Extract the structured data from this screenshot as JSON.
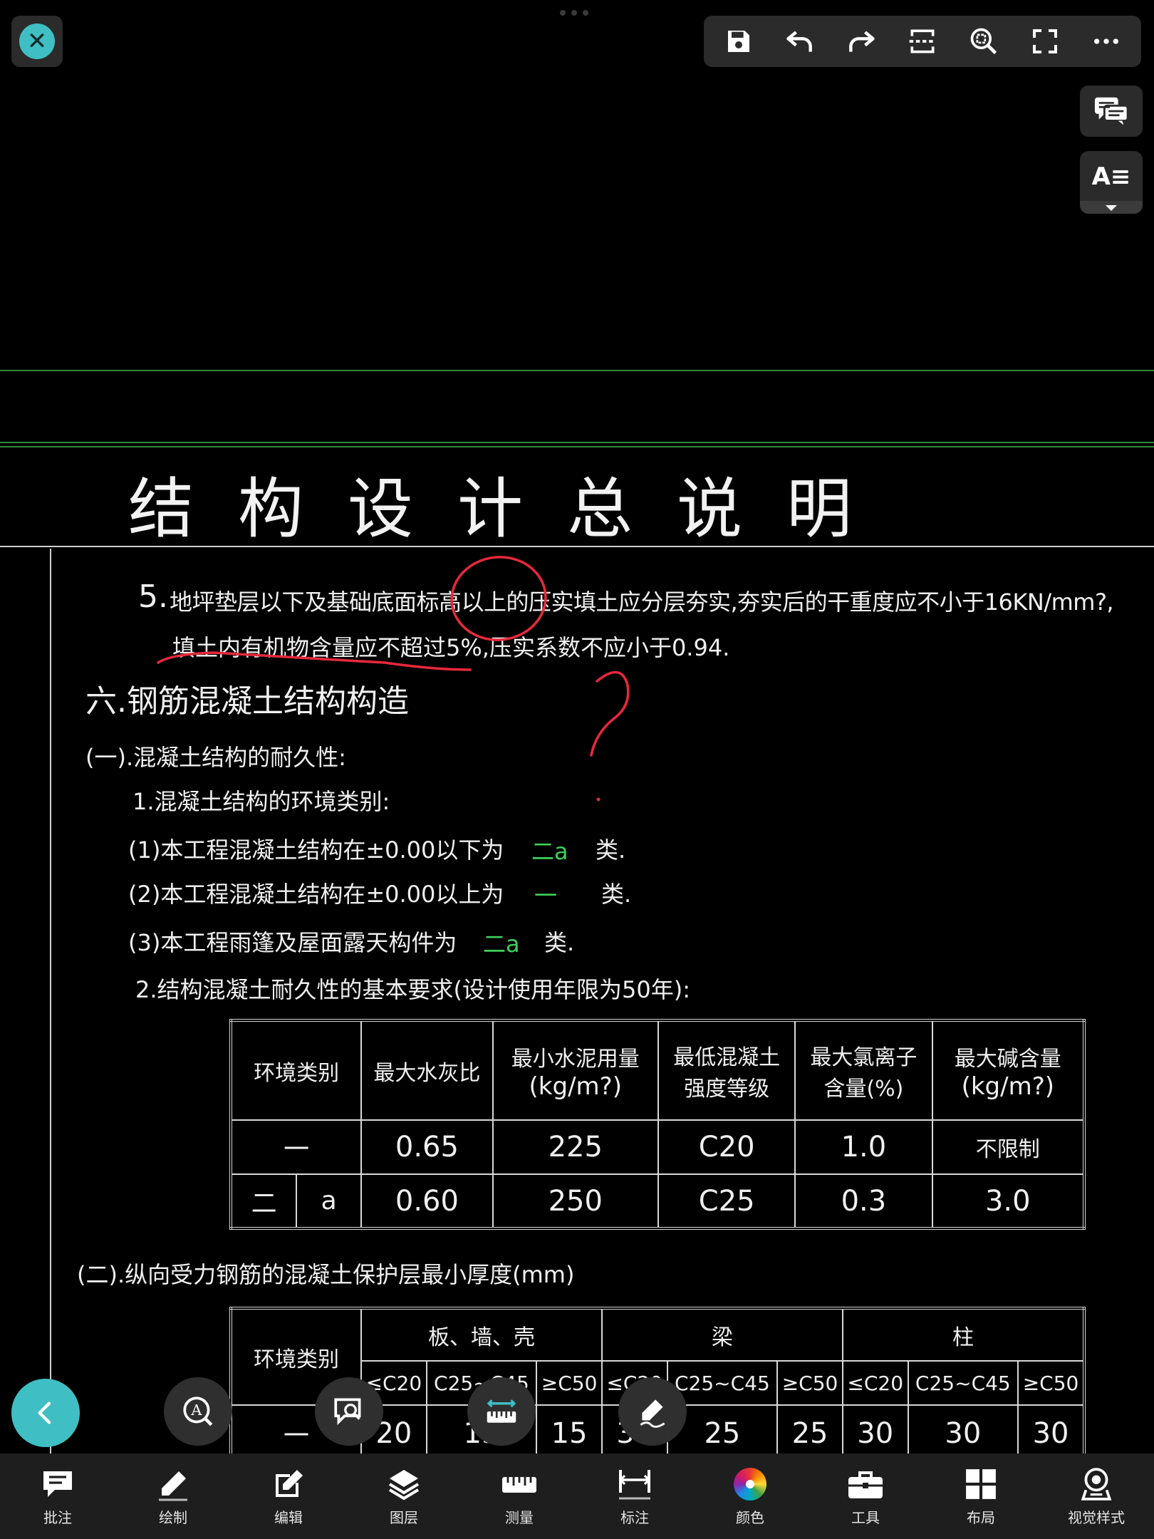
{
  "toolbar": {
    "icons": [
      "save-icon",
      "undo-icon",
      "redo-icon",
      "cut-section-icon",
      "zoom-window-icon",
      "fullscreen-icon",
      "more-icon"
    ]
  },
  "side": {
    "text_style_label": "A≡"
  },
  "drawing": {
    "title_chars": [
      "结",
      "构",
      "设",
      "计",
      "总",
      "说",
      "明"
    ],
    "item5_line1_a": "5.",
    "item5_line1_b": "地坪垫层以下及基础底面标高以上的压实填土应分层夯实,夯实后的干重度应不小于16KN/mm?,",
    "item5_line2": "填土内有机物含量应不超过5%,压实系数不应小于0.94.",
    "section6": "六.钢筋混凝土结构构造",
    "sub1": "(一).混凝土结构的耐久性:",
    "env1": "1.混凝土结构的环境类别:",
    "env_line1": "(1)本工程混凝土结构在±0.00以下为",
    "env_line1_val": "二a",
    "env_line1_unit": "类.",
    "env_line2": "(2)本工程混凝土结构在±0.00以上为",
    "env_line2_val": "一",
    "env_line2_unit": "类.",
    "env_line3": "(3)本工程雨篷及屋面露天构件为",
    "env_line3_val": "二a",
    "env_line3_unit": "类.",
    "req2": "2.结构混凝土耐久性的基本要求(设计使用年限为50年):",
    "table1": {
      "headers": [
        "环境类别",
        "最大水灰比",
        "最小水泥用量",
        "(kg/m?)",
        "最低混凝土",
        "强度等级",
        "最大氯离子",
        "含量(%)",
        "最大碱含量",
        "(kg/m?)"
      ],
      "row1": [
        "一",
        "0.65",
        "225",
        "C20",
        "1.0",
        "不限制"
      ],
      "row2": [
        "二",
        "a",
        "0.60",
        "250",
        "C25",
        "0.3",
        "3.0"
      ]
    },
    "sub2": "(二).纵向受力钢筋的混凝土保护层最小厚度(mm)",
    "table2": {
      "h_env": "环境类别",
      "h_slab": "板、墙、壳",
      "h_beam": "梁",
      "h_col": "柱",
      "sub": [
        "≤C20",
        "C25~C45",
        "≥C50",
        "≤C20",
        "C25~C45",
        "≥C50",
        "≤C20",
        "C25~C45",
        "≥C50"
      ],
      "row1_label": "一",
      "row1": [
        "20",
        "15",
        "15",
        "30",
        "25",
        "25",
        "30",
        "30",
        "30"
      ]
    }
  },
  "bottom_nav": [
    {
      "label": "批注",
      "icon": "comment-icon"
    },
    {
      "label": "绘制",
      "icon": "pencil-icon"
    },
    {
      "label": "编辑",
      "icon": "edit-icon"
    },
    {
      "label": "图层",
      "icon": "layers-icon"
    },
    {
      "label": "测量",
      "icon": "ruler-icon"
    },
    {
      "label": "标注",
      "icon": "dimension-icon"
    },
    {
      "label": "颜色",
      "icon": "color-wheel-icon"
    },
    {
      "label": "工具",
      "icon": "toolbox-icon"
    },
    {
      "label": "布局",
      "icon": "layout-icon"
    },
    {
      "label": "视觉样式",
      "icon": "visual-style-icon"
    }
  ],
  "colors": {
    "accent": "#3fbfc4",
    "annotation": "#e8283c",
    "cad_green": "#2e8b3a",
    "value_green": "#3fcf5a"
  }
}
